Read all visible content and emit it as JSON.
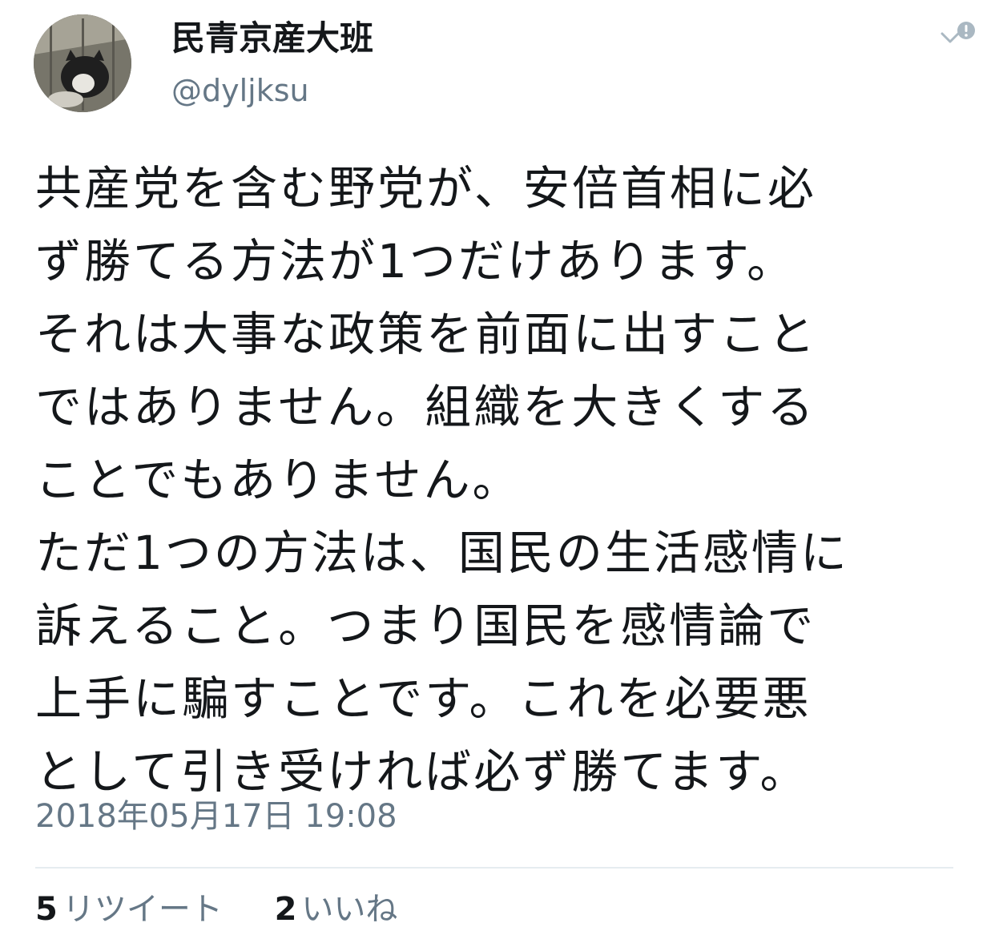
{
  "user": {
    "display_name": "民青京産大班",
    "handle": "@dyljksu",
    "avatar_icon": "cat-photo-avatar"
  },
  "menu_icon": "chevron-down-icon",
  "tweet": {
    "lines": [
      "共産党を含む野党が、安倍首相に必",
      "ず勝てる方法が1つだけあります。",
      "それは大事な政策を前面に出すこと",
      "ではありません。組織を大きくする",
      "ことでもありません。",
      "ただ1つの方法は、国民の生活感情に",
      "訴えること。つまり国民を感情論で",
      "上手に騙すことです。これを必要悪",
      "として引き受ければ必ず勝てます。"
    ],
    "timestamp": "2018年05月17日 19:08"
  },
  "stats": {
    "retweets_count": "5",
    "retweets_label": "リツイート",
    "likes_count": "2",
    "likes_label": "いいね"
  },
  "colors": {
    "text": "#14171a",
    "secondary": "#657786",
    "divider": "#e6ecf0"
  }
}
